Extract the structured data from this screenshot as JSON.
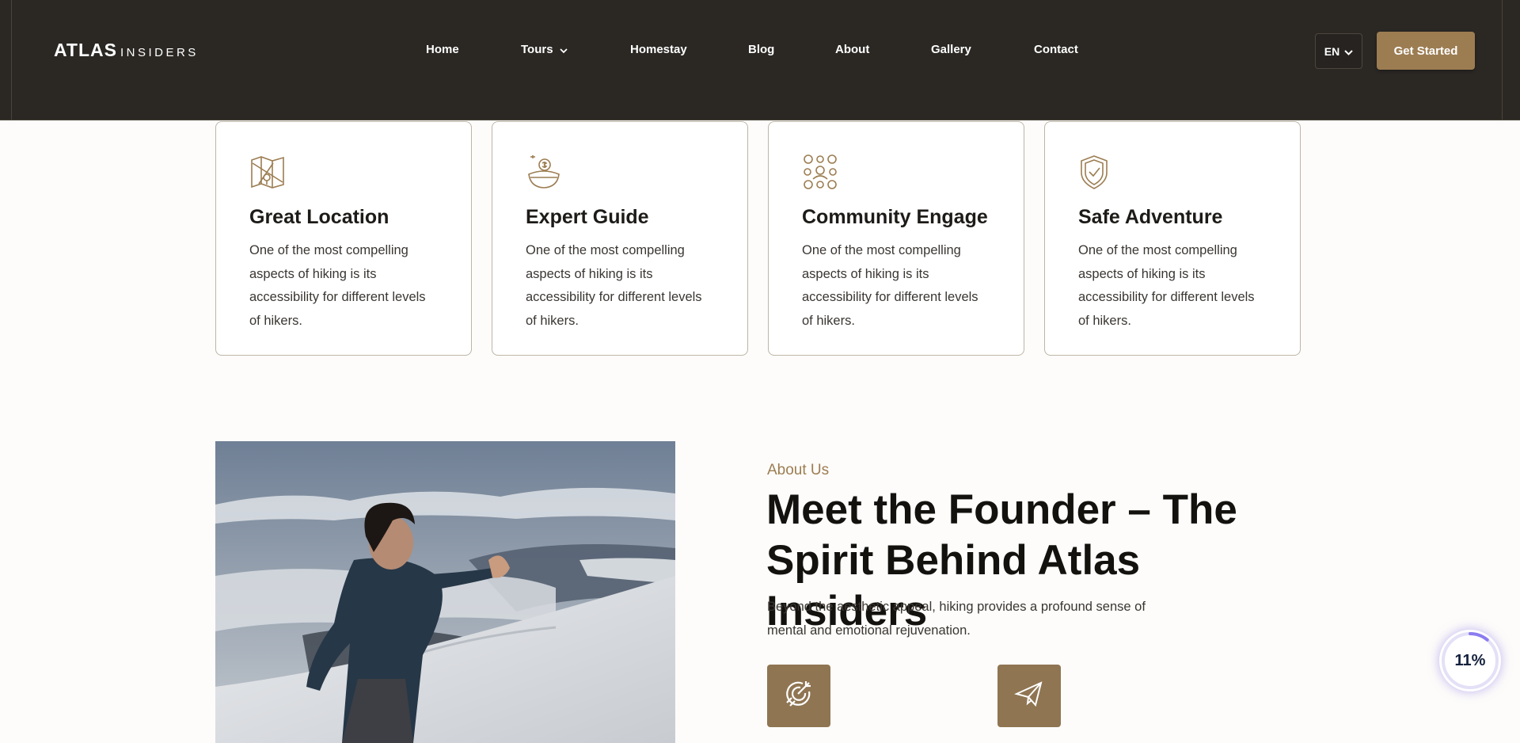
{
  "colors": {
    "header_bg": "#2b2824",
    "accent_gold": "#9c7d52",
    "icon_box": "#8f7552",
    "card_border": "#bdb5a7",
    "progress_ring": "#8b7cf0"
  },
  "header": {
    "logo": {
      "main": "ATLAS",
      "sub": "INSIDERS"
    },
    "nav": [
      {
        "label": "Home"
      },
      {
        "label": "Tours",
        "icon": "chevron-down-icon"
      },
      {
        "label": "Homestay"
      },
      {
        "label": "Blog"
      },
      {
        "label": "About"
      },
      {
        "label": "Gallery"
      },
      {
        "label": "Contact"
      }
    ],
    "language": {
      "label": "EN",
      "icon": "chevron-down-icon"
    },
    "cta_label": "Get Started"
  },
  "features": [
    {
      "title": "Great Location",
      "text": "One of the most compelling aspects of hiking is its accessibility for different levels of hikers.",
      "icon": "map-icon"
    },
    {
      "title": "Expert Guide",
      "text": "One of the most compelling aspects of hiking is its accessibility for different levels of hikers.",
      "icon": "guide-icon"
    },
    {
      "title": "Community Engage",
      "text": "One of the most compelling aspects of hiking is its accessibility for different levels of hikers.",
      "icon": "community-icon"
    },
    {
      "title": "Safe Adventure",
      "text": "One of the most compelling aspects of hiking is its accessibility for different levels of hikers.",
      "icon": "shield-icon"
    }
  ],
  "about": {
    "eyebrow": "About Us",
    "title": "Meet the Founder – The Spirit Behind Atlas Insiders",
    "description": "Beyond the aesthetic appeal, hiking provides a profound sense of mental and emotional rejuvenation.",
    "feature_icons": [
      "target-icon",
      "paper-plane-icon"
    ]
  },
  "scroll_progress": {
    "label": "11%",
    "value": 0.11
  }
}
